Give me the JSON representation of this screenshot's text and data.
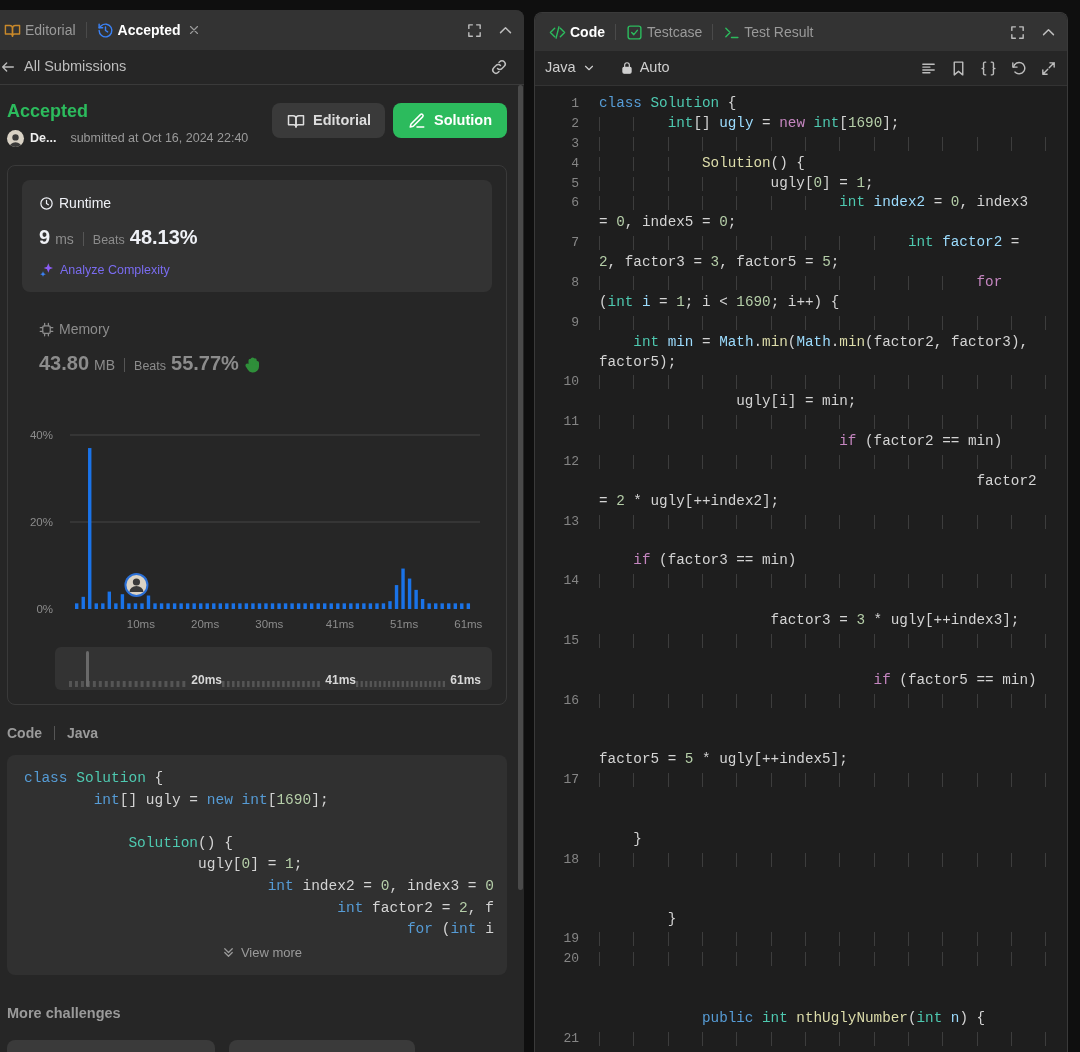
{
  "left_panel": {
    "tabs": [
      {
        "kind": "editorial",
        "label": "Editorial",
        "selected": false,
        "closable": false
      },
      {
        "kind": "submission",
        "label": "Accepted",
        "selected": true,
        "closable": true
      }
    ],
    "back_link": "All Submissions",
    "status": "Accepted",
    "author": "De...",
    "submitted": "submitted at Oct 16, 2024 22:40",
    "buttons": [
      {
        "kind": "secondary",
        "label": "Editorial"
      },
      {
        "kind": "primary",
        "label": "Solution"
      }
    ],
    "metrics": [
      {
        "kind": "runtime",
        "selected": true,
        "label": "Runtime",
        "value": "9",
        "unit": "ms",
        "beats_label": "Beats",
        "beats": "48.13%",
        "link": "Analyze Complexity"
      },
      {
        "kind": "memory",
        "selected": false,
        "label": "Memory",
        "value": "43.80",
        "unit": "MB",
        "beats_label": "Beats",
        "beats": "55.77%"
      }
    ],
    "chart_data": {
      "type": "bar",
      "ylim": [
        0,
        40
      ],
      "yticks": [
        {
          "value": 0,
          "label": "0%"
        },
        {
          "value": 20,
          "label": "20%"
        },
        {
          "value": 40,
          "label": "40%"
        }
      ],
      "xlim": [
        0,
        61
      ],
      "x": [
        0,
        1.02,
        2.03,
        3.05,
        4.07,
        5.08,
        6.1,
        7.12,
        8.13,
        9.15,
        10.17,
        11.18,
        12.2,
        13.22,
        14.23,
        15.25,
        16.27,
        17.28,
        18.3,
        19.32,
        20.33,
        21.35,
        22.37,
        23.38,
        24.4,
        25.42,
        26.43,
        27.45,
        28.47,
        29.48,
        30.5,
        31.52,
        32.53,
        33.55,
        34.57,
        35.58,
        36.6,
        37.62,
        38.63,
        39.65,
        40.67,
        41.68,
        42.7,
        43.72,
        44.73,
        45.75,
        46.77,
        47.78,
        48.8,
        49.82,
        50.83,
        51.85,
        52.87,
        53.88,
        54.9,
        55.92,
        56.93,
        57.95,
        58.97,
        59.98,
        61
      ],
      "xticks": [
        {
          "value": 10,
          "label": "10ms"
        },
        {
          "value": 20,
          "label": "20ms"
        },
        {
          "value": 30,
          "label": "30ms"
        },
        {
          "value": 41,
          "label": "41ms"
        },
        {
          "value": 51,
          "label": "51ms"
        },
        {
          "value": 61,
          "label": "61ms"
        }
      ],
      "series": [
        {
          "color": "#1a73e8",
          "values": [
            1.3,
            2.8,
            37,
            1.3,
            1.3,
            4,
            1.3,
            3.4,
            1.3,
            1.3,
            1.3,
            3.1,
            1.3,
            1.3,
            1.3,
            1.3,
            1.3,
            1.3,
            1.3,
            1.3,
            1.3,
            1.3,
            1.3,
            1.3,
            1.3,
            1.3,
            1.3,
            1.3,
            1.3,
            1.3,
            1.3,
            1.3,
            1.3,
            1.3,
            1.3,
            1.3,
            1.3,
            1.3,
            1.3,
            1.3,
            1.3,
            1.3,
            1.3,
            1.3,
            1.3,
            1.3,
            1.3,
            1.3,
            1.8,
            5.5,
            9.3,
            7,
            4.4,
            2.3,
            1.3,
            1.3,
            1.3,
            1.3,
            1.3,
            1.3,
            1.3
          ]
        }
      ]
    },
    "range": {
      "level": 0.07,
      "labels": [
        "20ms",
        "41ms",
        "61ms"
      ]
    },
    "code_header": [
      "Code",
      "Java"
    ],
    "code_preview": [
      {
        "kind": "line",
        "tokens": [
          {
            "text": "class ",
            "kind": "kw"
          },
          {
            "text": "Solution",
            "kind": "type"
          },
          {
            "text": " {",
            "kind": "plain"
          }
        ]
      },
      {
        "kind": "line",
        "tokens": [
          {
            "text": "        int",
            "kind": "kw"
          },
          {
            "text": "[] ugly = ",
            "kind": "plain"
          },
          {
            "text": "new int",
            "kind": "kw"
          },
          {
            "text": "[",
            "kind": "plain"
          },
          {
            "text": "1690",
            "kind": "num"
          },
          {
            "text": "];",
            "kind": "plain"
          }
        ]
      },
      {
        "kind": "blank"
      },
      {
        "kind": "line",
        "tokens": [
          {
            "text": "            Solution",
            "kind": "type"
          },
          {
            "text": "() {",
            "kind": "plain"
          }
        ]
      },
      {
        "kind": "line",
        "tokens": [
          {
            "text": "                    ugly[",
            "kind": "plain"
          },
          {
            "text": "0",
            "kind": "num"
          },
          {
            "text": "] = ",
            "kind": "plain"
          },
          {
            "text": "1",
            "kind": "num"
          },
          {
            "text": ";",
            "kind": "plain"
          }
        ]
      },
      {
        "kind": "line",
        "tokens": [
          {
            "text": "                            int ",
            "kind": "kw"
          },
          {
            "text": "index2 = ",
            "kind": "plain"
          },
          {
            "text": "0",
            "kind": "num"
          },
          {
            "text": ", index3 = ",
            "kind": "plain"
          },
          {
            "text": "0",
            "kind": "num"
          }
        ]
      },
      {
        "kind": "line",
        "tokens": [
          {
            "text": "                                    int ",
            "kind": "kw"
          },
          {
            "text": "factor2 = ",
            "kind": "plain"
          },
          {
            "text": "2",
            "kind": "num"
          },
          {
            "text": ", f",
            "kind": "plain"
          }
        ]
      },
      {
        "kind": "line",
        "tokens": [
          {
            "text": "                                            for ",
            "kind": "kw"
          },
          {
            "text": "(",
            "kind": "plain"
          },
          {
            "text": "int ",
            "kind": "kw"
          },
          {
            "text": "i",
            "kind": "plain"
          }
        ]
      }
    ],
    "view_more": "View more",
    "more_challenges": "More challenges",
    "challenge_cards": [
      {
        "kind": "challenge"
      },
      {
        "kind": "challenge"
      }
    ]
  },
  "right_panel": {
    "tabs": [
      {
        "kind": "code",
        "label": "Code",
        "selected": true
      },
      {
        "kind": "testcase",
        "label": "Testcase",
        "selected": false
      },
      {
        "kind": "result",
        "label": "Test Result",
        "selected": false
      }
    ],
    "language": "Java",
    "mode": "Auto",
    "editor_rows": [
      {
        "kind": "numbered",
        "number": "1",
        "tokens": [
          {
            "text": "class ",
            "kind": "kw"
          },
          {
            "text": "Solution",
            "kind": "type"
          },
          {
            "text": " {",
            "kind": "plain"
          }
        ]
      },
      {
        "kind": "numbered",
        "number": "2",
        "tokens": [
          {
            "text": "        int",
            "kind": "type"
          },
          {
            "text": "[] ",
            "kind": "plain"
          },
          {
            "text": "ugly",
            "kind": "var"
          },
          {
            "text": " = ",
            "kind": "plain"
          },
          {
            "text": "new ",
            "kind": "ctrl"
          },
          {
            "text": "int",
            "kind": "type"
          },
          {
            "text": "[",
            "kind": "plain"
          },
          {
            "text": "1690",
            "kind": "num"
          },
          {
            "text": "];",
            "kind": "plain"
          }
        ]
      },
      {
        "kind": "numbered",
        "number": "3"
      },
      {
        "kind": "numbered",
        "number": "4",
        "tokens": [
          {
            "text": "            Solution",
            "kind": "fn"
          },
          {
            "text": "() {",
            "kind": "plain"
          }
        ]
      },
      {
        "kind": "numbered",
        "number": "5",
        "tokens": [
          {
            "text": "                    ugly[",
            "kind": "plain"
          },
          {
            "text": "0",
            "kind": "num"
          },
          {
            "text": "] = ",
            "kind": "plain"
          },
          {
            "text": "1",
            "kind": "num"
          },
          {
            "text": ";",
            "kind": "plain"
          }
        ]
      },
      {
        "kind": "numbered",
        "number": "6",
        "tokens": [
          {
            "text": "                            int ",
            "kind": "type"
          },
          {
            "text": "index2",
            "kind": "var"
          },
          {
            "text": " = ",
            "kind": "plain"
          },
          {
            "text": "0",
            "kind": "num"
          },
          {
            "text": ", index3",
            "kind": "plain"
          }
        ]
      },
      {
        "kind": "wrap",
        "tokens": [
          {
            "text": "= ",
            "kind": "plain"
          },
          {
            "text": "0",
            "kind": "num"
          },
          {
            "text": ", index5 = ",
            "kind": "plain"
          },
          {
            "text": "0",
            "kind": "num"
          },
          {
            "text": ";",
            "kind": "plain"
          }
        ]
      },
      {
        "kind": "numbered",
        "number": "7",
        "tokens": [
          {
            "text": "                                    int ",
            "kind": "type"
          },
          {
            "text": "factor2",
            "kind": "var"
          },
          {
            "text": " =",
            "kind": "plain"
          }
        ]
      },
      {
        "kind": "wrap",
        "tokens": [
          {
            "text": "2",
            "kind": "num"
          },
          {
            "text": ", factor3 = ",
            "kind": "plain"
          },
          {
            "text": "3",
            "kind": "num"
          },
          {
            "text": ", factor5 = ",
            "kind": "plain"
          },
          {
            "text": "5",
            "kind": "num"
          },
          {
            "text": ";",
            "kind": "plain"
          }
        ]
      },
      {
        "kind": "numbered",
        "number": "8",
        "tokens": [
          {
            "text": "                                            for",
            "kind": "ctrl"
          }
        ]
      },
      {
        "kind": "wrap",
        "tokens": [
          {
            "text": "(",
            "kind": "plain"
          },
          {
            "text": "int ",
            "kind": "type"
          },
          {
            "text": "i",
            "kind": "var"
          },
          {
            "text": " = ",
            "kind": "plain"
          },
          {
            "text": "1",
            "kind": "num"
          },
          {
            "text": "; i < ",
            "kind": "plain"
          },
          {
            "text": "1690",
            "kind": "num"
          },
          {
            "text": "; i++) {",
            "kind": "plain"
          }
        ]
      },
      {
        "kind": "numbered",
        "number": "9"
      },
      {
        "kind": "wrap",
        "tokens": [
          {
            "text": "    int ",
            "kind": "type"
          },
          {
            "text": "min",
            "kind": "var"
          },
          {
            "text": " = ",
            "kind": "plain"
          },
          {
            "text": "Math",
            "kind": "var"
          },
          {
            "text": ".",
            "kind": "plain"
          },
          {
            "text": "min",
            "kind": "fn"
          },
          {
            "text": "(",
            "kind": "plain"
          },
          {
            "text": "Math",
            "kind": "var"
          },
          {
            "text": ".",
            "kind": "plain"
          },
          {
            "text": "min",
            "kind": "fn"
          },
          {
            "text": "(factor2, factor3),",
            "kind": "plain"
          }
        ]
      },
      {
        "kind": "wrap",
        "tokens": [
          {
            "text": "factor5);",
            "kind": "plain"
          }
        ]
      },
      {
        "kind": "numbered",
        "number": "10"
      },
      {
        "kind": "wrap",
        "tokens": [
          {
            "text": "                ugly[i] = min;",
            "kind": "plain"
          }
        ]
      },
      {
        "kind": "numbered",
        "number": "11"
      },
      {
        "kind": "wrap",
        "tokens": [
          {
            "text": "                            if ",
            "kind": "ctrl"
          },
          {
            "text": "(factor2 == min)",
            "kind": "plain"
          }
        ]
      },
      {
        "kind": "numbered",
        "number": "12"
      },
      {
        "kind": "wrap",
        "tokens": [
          {
            "text": "                                            factor2",
            "kind": "plain"
          }
        ]
      },
      {
        "kind": "wrap",
        "tokens": [
          {
            "text": "= ",
            "kind": "plain"
          },
          {
            "text": "2",
            "kind": "num"
          },
          {
            "text": " * ugly[++index2];",
            "kind": "plain"
          }
        ]
      },
      {
        "kind": "numbered",
        "number": "13"
      },
      {
        "kind": "blank"
      },
      {
        "kind": "wrap",
        "tokens": [
          {
            "text": "    if ",
            "kind": "ctrl"
          },
          {
            "text": "(factor3 == min)",
            "kind": "plain"
          }
        ]
      },
      {
        "kind": "numbered",
        "number": "14"
      },
      {
        "kind": "blank"
      },
      {
        "kind": "wrap",
        "tokens": [
          {
            "text": "                    factor3 = ",
            "kind": "plain"
          },
          {
            "text": "3",
            "kind": "num"
          },
          {
            "text": " * ugly[++index3];",
            "kind": "plain"
          }
        ]
      },
      {
        "kind": "numbered",
        "number": "15"
      },
      {
        "kind": "blank"
      },
      {
        "kind": "wrap",
        "tokens": [
          {
            "text": "                                if ",
            "kind": "ctrl"
          },
          {
            "text": "(factor5 == min)",
            "kind": "plain"
          }
        ]
      },
      {
        "kind": "numbered",
        "number": "16"
      },
      {
        "kind": "blank"
      },
      {
        "kind": "blank"
      },
      {
        "kind": "wrap",
        "tokens": [
          {
            "text": "factor5 = ",
            "kind": "plain"
          },
          {
            "text": "5",
            "kind": "num"
          },
          {
            "text": " * ugly[++index5];",
            "kind": "plain"
          }
        ]
      },
      {
        "kind": "numbered",
        "number": "17"
      },
      {
        "kind": "blank"
      },
      {
        "kind": "blank"
      },
      {
        "kind": "wrap",
        "tokens": [
          {
            "text": "    }",
            "kind": "plain"
          }
        ]
      },
      {
        "kind": "numbered",
        "number": "18"
      },
      {
        "kind": "blank"
      },
      {
        "kind": "blank"
      },
      {
        "kind": "wrap",
        "tokens": [
          {
            "text": "        }",
            "kind": "plain"
          }
        ]
      },
      {
        "kind": "numbered",
        "number": "19"
      },
      {
        "kind": "numbered",
        "number": "20"
      },
      {
        "kind": "blank"
      },
      {
        "kind": "blank"
      },
      {
        "kind": "wrap",
        "tokens": [
          {
            "text": "            public ",
            "kind": "kw"
          },
          {
            "text": "int ",
            "kind": "type"
          },
          {
            "text": "nthUglyNumber",
            "kind": "fn"
          },
          {
            "text": "(",
            "kind": "plain"
          },
          {
            "text": "int ",
            "kind": "type"
          },
          {
            "text": "n",
            "kind": "var"
          },
          {
            "text": ") {",
            "kind": "plain"
          }
        ]
      },
      {
        "kind": "numbered",
        "number": "21"
      }
    ]
  }
}
